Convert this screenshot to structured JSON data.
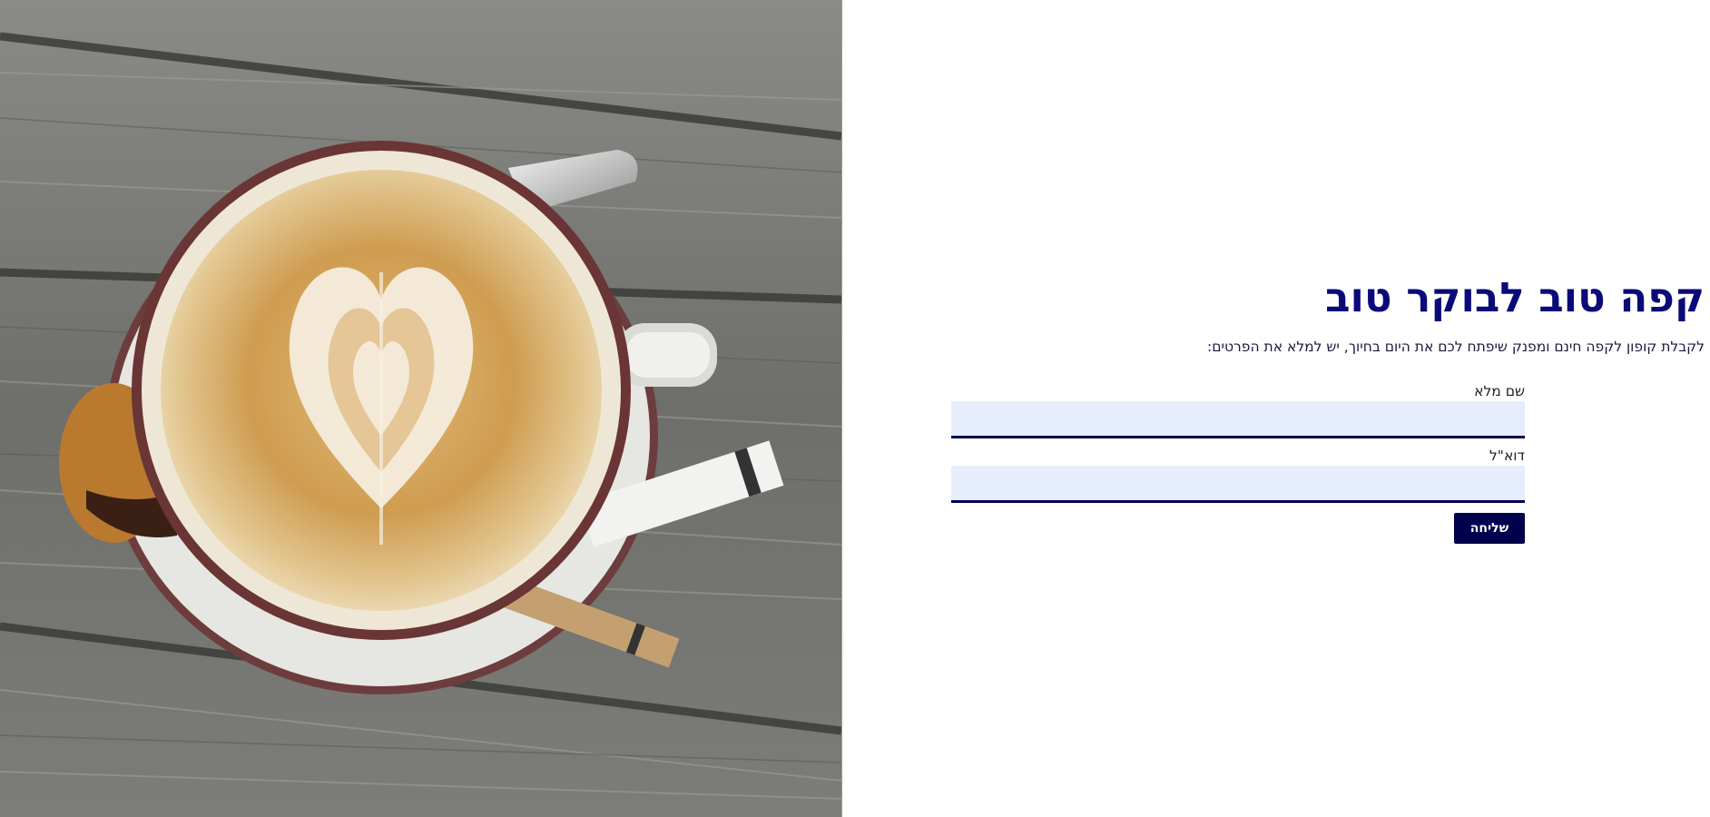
{
  "hero": {
    "image_alt": "כוס קפה עם לאטה ארט בצורת לב",
    "colors": {
      "wood": "#7a7a76",
      "cup_rim": "#6b3a3a",
      "cup_body": "#ece7dc",
      "coffee": "#c99a52"
    }
  },
  "page": {
    "title": "קפה טוב לבוקר טוב",
    "subtitle": "לקבלת קופון לקפה חינם ומפנק שיפתח לכם את היום בחיוך, יש למלא את הפרטים:"
  },
  "form": {
    "full_name_label": "שם מלא",
    "full_name_value": "",
    "email_label": "דוא\"ל",
    "email_value": "",
    "submit_label": "שליחה"
  },
  "colors": {
    "title": "#0a0a78",
    "accent": "#00004d",
    "input_bg": "#e6eefd"
  }
}
